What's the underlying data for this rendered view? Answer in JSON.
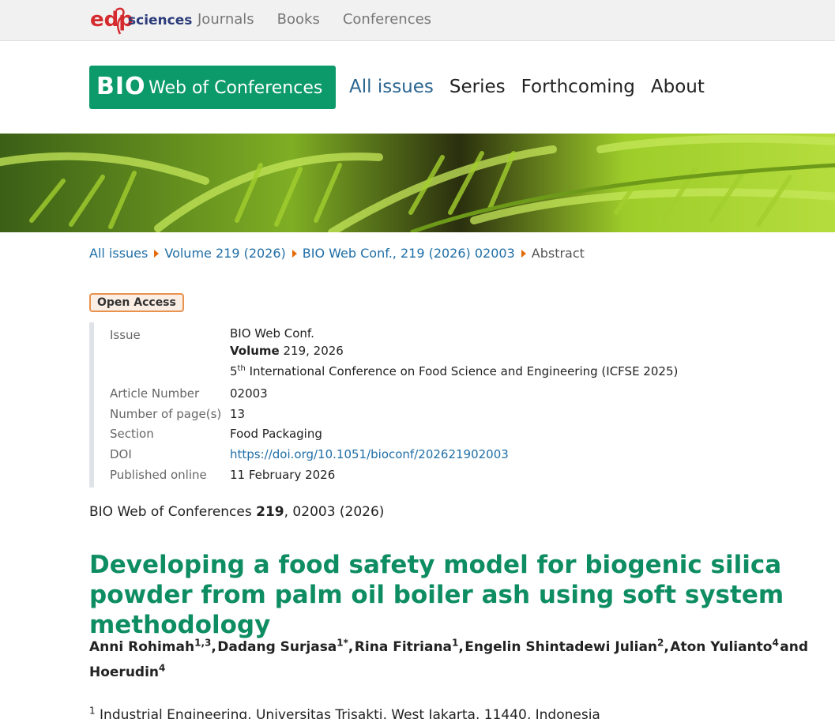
{
  "colors": {
    "brand_green": "#0d9a6b",
    "link_blue": "#1f6ea6",
    "title_green": "#0e8d63",
    "oa_orange": "#e8924f"
  },
  "topbar": {
    "logo": {
      "part_a": "edp",
      "part_b": "sciences"
    },
    "nav": [
      "Journals",
      "Books",
      "Conferences"
    ]
  },
  "header": {
    "logo": {
      "bio": "BIO",
      "rest": "Web of Conferences"
    },
    "nav": [
      "All issues",
      "Series",
      "Forthcoming",
      "About"
    ]
  },
  "breadcrumb": {
    "items": [
      "All issues",
      "Volume 219 (2026)",
      "BIO Web Conf., 219 (2026) 02003"
    ],
    "current": "Abstract"
  },
  "badge": "Open Access",
  "meta": {
    "issue_label": "Issue",
    "issue_journal": "BIO Web Conf.",
    "issue_volume_label": "Volume",
    "issue_volume_rest": " 219, 2026",
    "issue_conf_num": "5",
    "issue_conf_sup": "th",
    "issue_conf_rest": " International Conference on Food Science and Engineering (ICFSE 2025)",
    "article_number_label": "Article Number",
    "article_number": "02003",
    "pages_label": "Number of page(s)",
    "pages": "13",
    "section_label": "Section",
    "section": "Food Packaging",
    "doi_label": "DOI",
    "doi": "https://doi.org/10.1051/bioconf/202621902003",
    "published_label": "Published online",
    "published": "11 February 2026"
  },
  "citation": {
    "journal": "BIO Web of Conferences ",
    "volume": "219",
    "rest": ", 02003 (2026)"
  },
  "title": "Developing a food safety model for biogenic silica powder from palm oil boiler ash using soft system methodology",
  "authors": [
    {
      "name": "Anni Rohimah",
      "sup": "1,3",
      "after": ","
    },
    {
      "name": "Dadang Surjasa",
      "sup": "1*",
      "after": ","
    },
    {
      "name": "Rina Fitriana",
      "sup": "1",
      "after": ","
    },
    {
      "name": "Engelin Shintadewi Julian",
      "sup": "2",
      "after": ","
    },
    {
      "name": "Aton Yulianto",
      "sup": "4",
      "after": ""
    }
  ],
  "authors_and": "and",
  "author_last": {
    "name": "Hoerudin",
    "sup": "4"
  },
  "affiliation": {
    "sup": "1",
    "text": " Industrial Engineering, Universitas Trisakti, West Jakarta, 11440, Indonesia"
  }
}
